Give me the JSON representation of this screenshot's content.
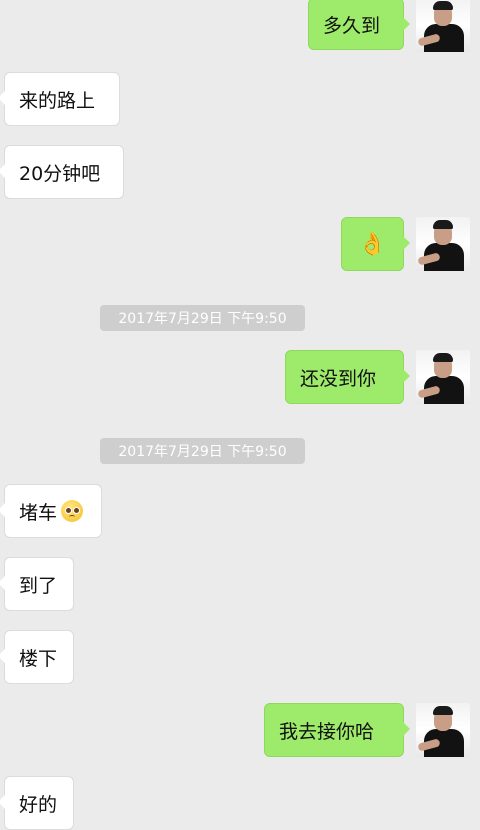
{
  "messages": [
    {
      "dir": "out",
      "text": "多久到"
    },
    {
      "dir": "in",
      "text": "来的路上"
    },
    {
      "dir": "in",
      "text": "20分钟吧"
    },
    {
      "dir": "out",
      "emoji": "ok-hand-emoji",
      "text": "👌"
    },
    {
      "timestamp": "2017年7月29日 下午9:50"
    },
    {
      "dir": "out",
      "text": "还没到你"
    },
    {
      "timestamp": "2017年7月29日 下午9:50"
    },
    {
      "dir": "in",
      "text": "堵车",
      "emoji": "flushed-face-emoji"
    },
    {
      "dir": "in",
      "text": "到了"
    },
    {
      "dir": "in",
      "text": "楼下"
    },
    {
      "dir": "out",
      "text": "我去接你哈"
    },
    {
      "dir": "in",
      "text": "好的"
    }
  ],
  "colors": {
    "background": "#ebebeb",
    "outgoing_bubble": "#9eea6a",
    "incoming_bubble": "#ffffff",
    "timestamp_pill": "#cecece"
  }
}
